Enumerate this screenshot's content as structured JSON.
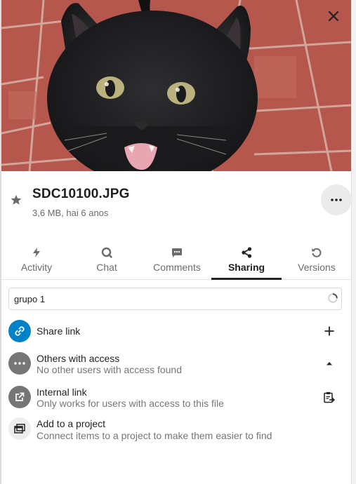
{
  "preview": {
    "alt": "Black kitten on red tiled floor"
  },
  "file": {
    "name": "SDC10100.JPG",
    "meta": "3,6 MB, hai 6 anos"
  },
  "tabs": [
    {
      "label": "Activity",
      "icon": "activity-icon"
    },
    {
      "label": "Chat",
      "icon": "chat-icon"
    },
    {
      "label": "Comments",
      "icon": "comments-icon"
    },
    {
      "label": "Sharing",
      "icon": "share-icon",
      "active": true
    },
    {
      "label": "Versions",
      "icon": "history-icon"
    }
  ],
  "search": {
    "value": "grupo 1"
  },
  "sharing": {
    "share_link": {
      "title": "Share link",
      "color": "#0082c9"
    },
    "others": {
      "title": "Others with access",
      "subtitle": "No other users with access found",
      "color": "#767676"
    },
    "internal": {
      "title": "Internal link",
      "subtitle": "Only works for users with access to this file",
      "color": "#767676"
    },
    "project": {
      "title": "Add to a project",
      "subtitle": "Connect items to a project to make them easier to find"
    }
  }
}
